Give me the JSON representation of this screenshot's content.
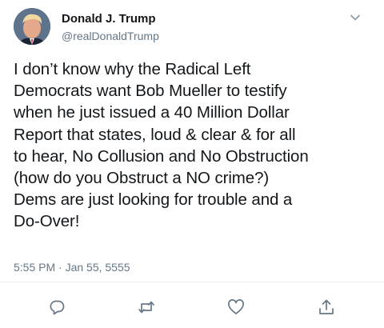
{
  "author": {
    "display_name": "Donald J. Trump",
    "handle": "@realDonaldTrump",
    "avatar_icon": "profile-photo"
  },
  "tweet": {
    "text": "I don’t know why the Radical Left\nDemocrats want Bob Mueller to testify\nwhen he just issued a 40 Million Dollar\nReport that states, loud & clear & for all\nto hear, No Collusion and No Obstruction\n(how do you Obstruct a NO crime?)\nDems are just looking for trouble and a\nDo-Over!",
    "timestamp": "5:55 PM · Jan 55, 5555"
  },
  "actions": {
    "reply_icon": "reply-icon",
    "retweet_icon": "retweet-icon",
    "like_icon": "heart-icon",
    "share_icon": "share-icon"
  },
  "colors": {
    "text": "#14171a",
    "secondary": "#657786",
    "divider": "#e6ecf0"
  }
}
